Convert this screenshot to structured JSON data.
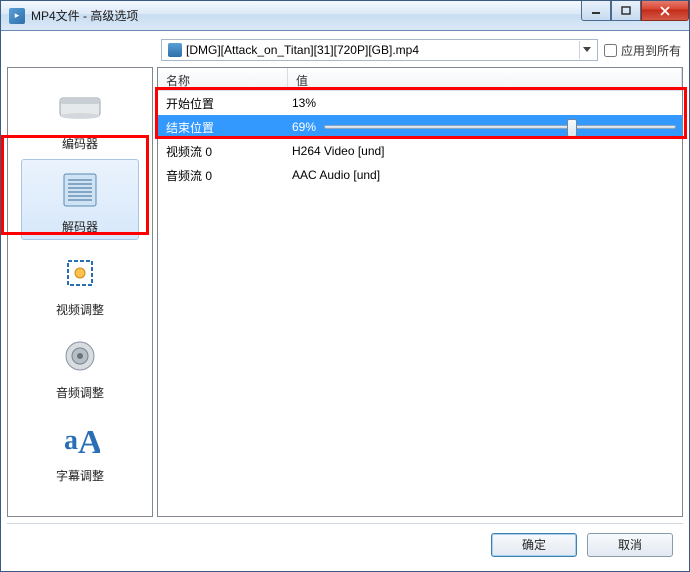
{
  "window": {
    "title": "MP4文件 - 高级选项"
  },
  "file_selector": {
    "filename": "[DMG][Attack_on_Titan][31][720P][GB].mp4",
    "apply_all_label": "应用到所有",
    "apply_all_checked": false
  },
  "sidebar": {
    "items": [
      {
        "key": "encoder",
        "label": "编码器"
      },
      {
        "key": "decoder",
        "label": "解码器"
      },
      {
        "key": "video-adjust",
        "label": "视频调整"
      },
      {
        "key": "audio-adjust",
        "label": "音频调整"
      },
      {
        "key": "subtitle-adjust",
        "label": "字幕调整"
      }
    ],
    "selected": "decoder"
  },
  "table": {
    "headers": {
      "name": "名称",
      "value": "值"
    },
    "rows": [
      {
        "name": "开始位置",
        "value": "13%",
        "selected": false,
        "slider": null
      },
      {
        "name": "结束位置",
        "value": "69%",
        "selected": true,
        "slider": 69
      },
      {
        "name": "视频流 0",
        "value": "H264 Video [und]",
        "selected": false,
        "slider": null
      },
      {
        "name": "音频流 0",
        "value": "AAC Audio [und]",
        "selected": false,
        "slider": null
      }
    ]
  },
  "buttons": {
    "ok": "确定",
    "cancel": "取消"
  }
}
